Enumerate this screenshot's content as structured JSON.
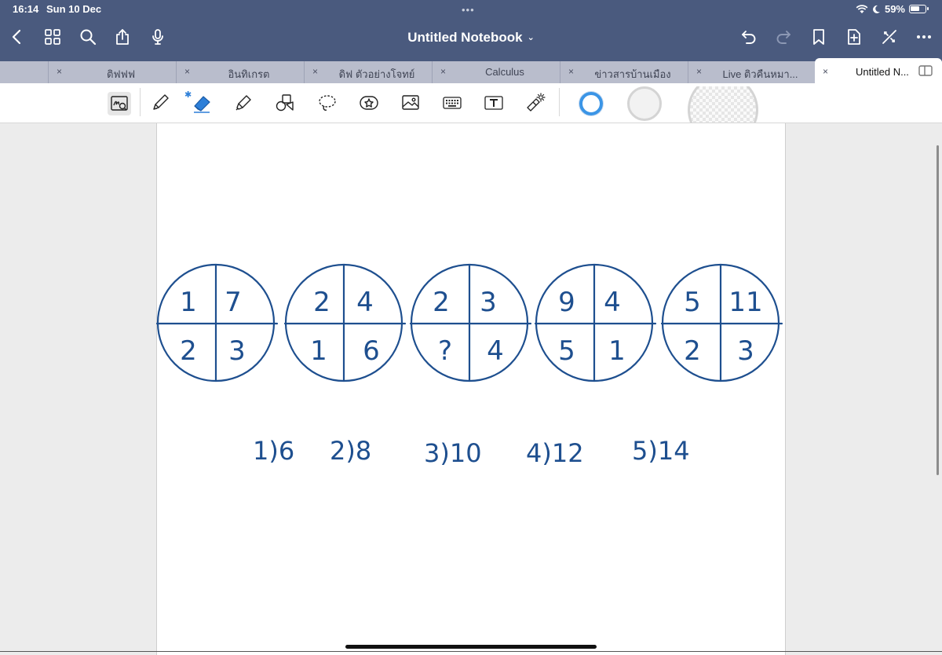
{
  "status": {
    "time": "16:14",
    "date": "Sun 10 Dec",
    "battery": "59%",
    "dots": "•••"
  },
  "nav": {
    "title": "Untitled Notebook",
    "title_chevron": "⌄"
  },
  "tabs": [
    {
      "label": "ติฟฟฟ"
    },
    {
      "label": "อินทิเกรต"
    },
    {
      "label": "ดิฟ ตัวอย่างโจทย์"
    },
    {
      "label": "Calculus"
    },
    {
      "label": "ข่าวสารบ้านเมือง"
    },
    {
      "label": "Live ติวคืนหมา..."
    },
    {
      "label": "Untitled N..."
    }
  ],
  "tab_close_glyph": "×",
  "colors": {
    "header": "#4a5a7e",
    "tabs": "#b9bdcc",
    "ink": "#1e4f8f",
    "pen_color": "#3b95e6"
  },
  "circles": [
    {
      "tl": "1",
      "tr": "7",
      "bl": "2",
      "br": "3"
    },
    {
      "tl": "2",
      "tr": "4",
      "bl": "1",
      "br": "6"
    },
    {
      "tl": "2",
      "tr": "3",
      "bl": "?",
      "br": "4"
    },
    {
      "tl": "9",
      "tr": "4",
      "bl": "5",
      "br": "1"
    },
    {
      "tl": "5",
      "tr": "11",
      "bl": "2",
      "br": "3"
    }
  ],
  "answers": [
    "1)6",
    "2)8",
    "3)10",
    "4)12",
    "5)14"
  ]
}
